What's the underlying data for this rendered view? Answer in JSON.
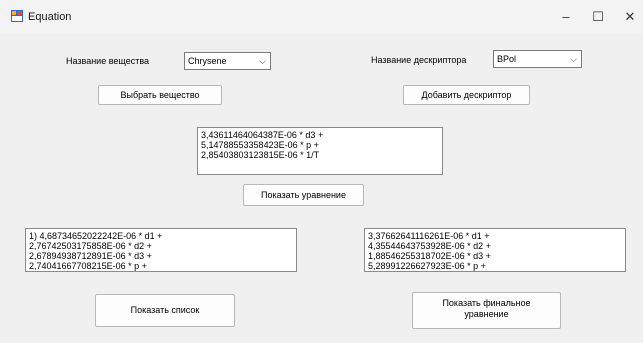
{
  "window": {
    "title": "Equation",
    "minimize": "–",
    "maximize": "☐",
    "close": "✕"
  },
  "substance": {
    "label": "Название вещества",
    "selected": "Chrysene",
    "button": "Выбрать вещество"
  },
  "descriptor": {
    "label": "Название дескриптора",
    "selected": "BPol",
    "button": "Добавить дескриптор"
  },
  "equation_box": {
    "lines": [
      "3,43611464064387E-06 * d3 +",
      "5,14788553358423E-06 * p +",
      "2,85403803123815E-06 * 1/T"
    ]
  },
  "show_equation_button": "Показать уравнение",
  "list_box": {
    "lines": [
      "1) 4,68734652022242E-06 * d1 +",
      "2,76742503175858E-06 * d2 +",
      "2,67894938712891E-06 * d3 +",
      "2,74041667708215E-06 * p +"
    ]
  },
  "final_box": {
    "lines": [
      "3,37662641116261E-06 * d1 +",
      "4,35544643753928E-06 * d2 +",
      "1,88546255318702E-06 * d3 +",
      "5,28991226627923E-06 * p +"
    ]
  },
  "show_list_button": "Показать список",
  "show_final_button": {
    "line1": "Показать финальное",
    "line2": "уравнение"
  }
}
